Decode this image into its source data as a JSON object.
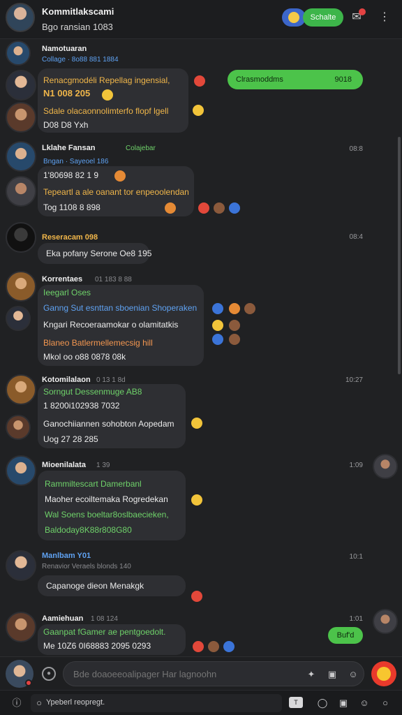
{
  "header": {
    "title": "Kommitlakscami",
    "subtitle": "Bgo ransian 1083",
    "action_label": "Schalte"
  },
  "messages": [
    {
      "name": "Namotuaran",
      "meta": "Collage · 8o88 881 1884"
    },
    {
      "lines": [
        "Renacgmodéli Repellag ingensial,",
        "N1 008 205"
      ],
      "out": "Clrasmoddms",
      "out_time": "9018"
    },
    {
      "lines": [
        "Sdale olacaonnolimterfo flopf lgell",
        "D08 D8 Yxh"
      ]
    },
    {
      "name": "Lklahe Fansan",
      "meta": "Colajebar",
      "time": "08:8"
    },
    {
      "lines": [
        "Bngan · Sayeoel 186",
        "1'80698 82 1 9"
      ]
    },
    {
      "lines": [
        "Tepeartl a ale oanant tor enpeoolendan",
        "Tog 1108 8 898"
      ]
    },
    {
      "name": "Reseracam 098",
      "time": "08:4",
      "lines": [
        "Eka pofany Serone Oe8 195"
      ]
    },
    {
      "name": "Korrentaes",
      "meta": "01 183 8 88",
      "lines": [
        "Ieegarl Oses",
        "Ganng Sut esnttan sboenian Shoperaken",
        "Kngari Recoeraamokar o olamitatkis",
        "Blaneo Batlermellemecsig hill",
        "Mkol oo o88 0878 08k"
      ]
    },
    {
      "name": "Kotomilalaon",
      "meta": "0 13 1 8d",
      "time": "10:27",
      "lines": [
        "Sorngut Dessenmuge AB8",
        "1 8200i102938 7032",
        "Ganochiiannen sohobton Aopedam",
        "Uog 27 28 285"
      ]
    },
    {
      "name": "Mioenilalata",
      "meta": "1 39",
      "time": "1:09",
      "lines": [
        "Rammiltescart Damerbanl",
        "Maoher ecoiltemaka Rogredekan",
        "Wal Soens boeltar8oslbaecieken,",
        "Baldoday8K88r808G80"
      ]
    },
    {
      "name": "Manlbam Y01",
      "meta": "Renavior Veraels blonds 140",
      "time": "10:1",
      "lines": [
        "Capanoge dieon Menakgk"
      ]
    },
    {
      "name": "Aamiehuan",
      "meta": "1 08 124",
      "time": "1:01",
      "lines": [
        "Gaanpat fGamer ae pentgoedolt.",
        "Me 10Z6 0I68883 2095 0293"
      ],
      "out": "Buf'd"
    }
  ],
  "composer": {
    "placeholder": "Bde doaoeeoalipager Har lagnoohn"
  },
  "bottombar": {
    "search_text": "Ypeberl reopregt.",
    "tag": "T"
  }
}
